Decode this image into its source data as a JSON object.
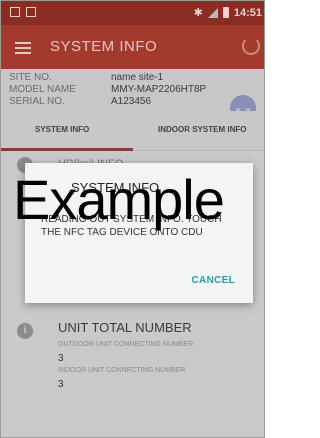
{
  "status_bar": {
    "time": "14:51",
    "icons": [
      "image-icon",
      "sd-card-icon",
      "bluetooth-icon",
      "signal-icon",
      "battery-icon"
    ]
  },
  "toolbar": {
    "title": "SYSTEM INFO",
    "menu_icon": "menu-icon",
    "refresh_icon": "refresh-icon"
  },
  "info": {
    "site_label": "SITE NO.",
    "site_value": "name site-1",
    "model_label": "MODEL NAME",
    "model_value": "MMY-MAP2206HT8P",
    "serial_label": "SERIAL NO.",
    "serial_value": "A123456"
  },
  "tabs": [
    {
      "label": "SYSTEM INFO",
      "selected": true
    },
    {
      "label": "INDOOR SYSTEM INFO",
      "selected": false
    }
  ],
  "section1": {
    "label": "HP(kw) INFO"
  },
  "dialog": {
    "title": "SYSTEM INFO",
    "message": "READING OUT SYSTEM INFO. TOUCH THE NFC TAG DEVICE ONTO CDU",
    "cancel_label": "CANCEL"
  },
  "watermark": "Example",
  "unit_total": {
    "title": "UNIT TOTAL NUMBER",
    "outdoor_label": "OUTDOOR UNIT CONNECTING NUMBER",
    "outdoor_value": "3",
    "indoor_label": "INDOOR UNIT CONNECTING NUMBER",
    "indoor_value": "3"
  },
  "colors": {
    "status_bar": "#8a2c22",
    "toolbar": "#a33a2e",
    "accent_cancel": "#2c9aa3"
  }
}
